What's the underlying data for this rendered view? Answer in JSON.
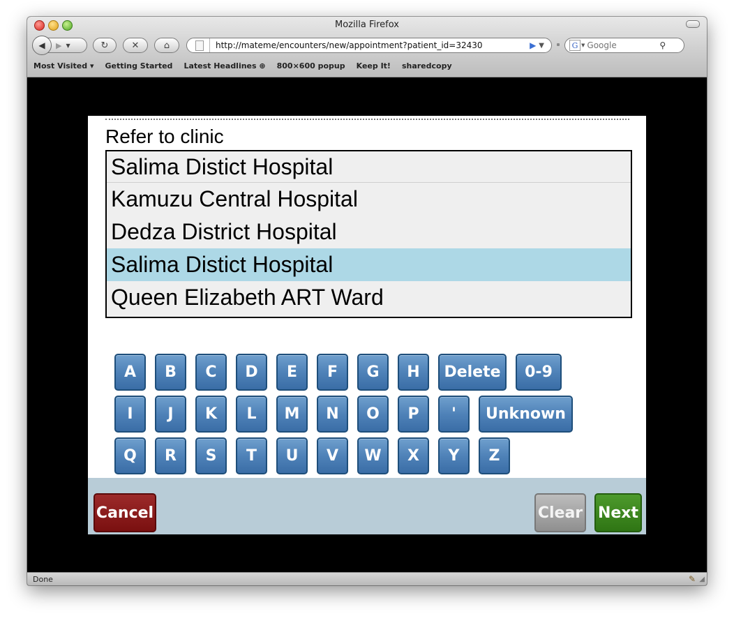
{
  "browser": {
    "window_title": "Mozilla Firefox",
    "url": "http://mateme/encounters/new/appointment?patient_id=32430",
    "search_placeholder": "Google",
    "bookmarks": [
      "Most Visited ▾",
      "Getting Started",
      "Latest Headlines ⊕",
      "800×600 popup",
      "Keep It!",
      "sharedcopy"
    ],
    "status_text": "Done"
  },
  "form": {
    "question": "Refer to clinic",
    "options": [
      "Salima Distict Hospital",
      "Kamuzu Central Hospital",
      "Dedza District Hospital",
      "Salima Distict Hospital",
      "Queen Elizabeth ART Ward"
    ],
    "selected_index": 3
  },
  "keyboard": {
    "row1": [
      "A",
      "B",
      "C",
      "D",
      "E",
      "F",
      "G",
      "H"
    ],
    "row2": [
      "I",
      "J",
      "K",
      "L",
      "M",
      "N",
      "O",
      "P",
      "'"
    ],
    "row3": [
      "Q",
      "R",
      "S",
      "T",
      "U",
      "V",
      "W",
      "X",
      "Y",
      "Z"
    ],
    "delete_label": "Delete",
    "numbers_label": "0-9",
    "unknown_label": "Unknown"
  },
  "footer": {
    "cancel_label": "Cancel",
    "clear_label": "Clear",
    "next_label": "Next"
  },
  "colors": {
    "selected_row": "#add8e6",
    "key_blue": "#4f82b8",
    "cancel_red": "#8a1a1a",
    "clear_gray": "#a6a6a6",
    "next_green": "#3d8a1f",
    "footer_bg": "#b8ccd7"
  },
  "icons": [
    "back-icon",
    "forward-icon",
    "reload-icon",
    "stop-icon",
    "home-icon",
    "page-icon",
    "go-arrow-icon",
    "google-icon",
    "magnifier-icon",
    "addon-icon",
    "resize-grip-icon"
  ]
}
